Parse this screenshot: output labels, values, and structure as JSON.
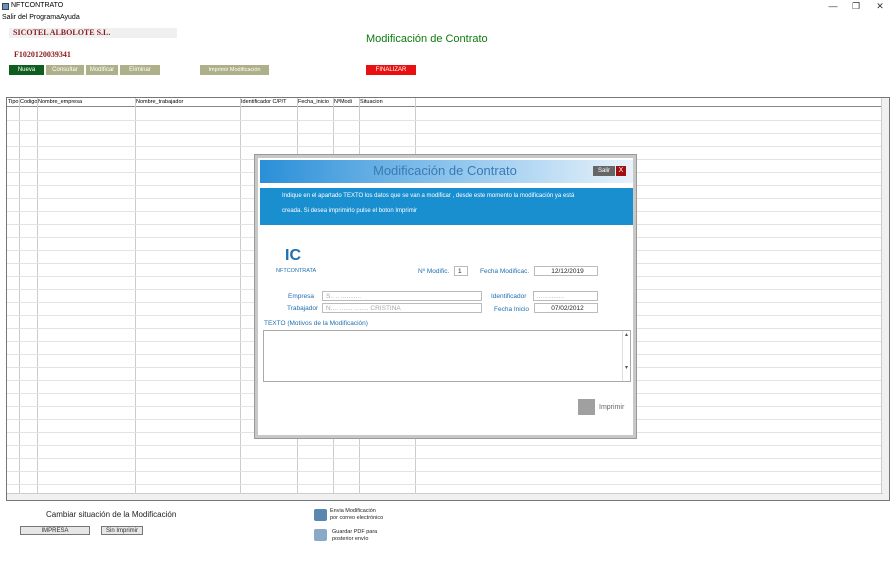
{
  "window": {
    "title": "NFTCONTRATO",
    "min": "—",
    "max": "❐",
    "close": "✕"
  },
  "menu": [
    "Salir del Programa",
    "Ayuda"
  ],
  "company": "SICOTEL ALBOLOTE S.L.",
  "code": "F1020120039341",
  "main_title": "Modificación de Contrato",
  "toolbar": {
    "nueva": "Nueva",
    "consultar": "Consultar",
    "modificar": "Modificar",
    "eliminar": "Eliminar",
    "imprimir": "Imprimir Modificación",
    "finalizar": "FINALIZAR"
  },
  "grid": {
    "columns": [
      "Tipo",
      "Codigo",
      "Nombre_empresa",
      "Nombre_trabajador",
      "Identificador C/P/T",
      "Fecha_inicio",
      "NºModi",
      "Situacion"
    ]
  },
  "dialog": {
    "title": "Modificación de Contrato",
    "salir": "Salir",
    "close": "X",
    "info_line1": "Indique en el apartado TEXTO los datos que se van a modificar , desde este momento la modificación ya está",
    "info_line2": "creada. Si desea imprimirlo pulse el boton Imprimir",
    "logo_mark": "IC",
    "logo_text": "NFTCONTRATA",
    "n_modif_label": "Nº Modific.",
    "n_modif_value": "1",
    "fecha_modif_label": "Fecha Modificac.",
    "fecha_modif_value": "12/12/2019",
    "empresa_label": "Empresa",
    "empresa_value": "S.. .. ...........",
    "identificador_label": "Identificador",
    "identificador_value": "...............",
    "trabajador_label": "Trabajador",
    "trabajador_value": "N.... ....... ........ CRISTINA",
    "fecha_inicio_label": "Fecha Inicio",
    "fecha_inicio_value": "07/02/2012",
    "texto_label": "TEXTO (Motivos de la Modificación)",
    "imprimir": "Imprimir"
  },
  "bottom": {
    "cambiar_label": "Cambiar situación de la Modificación",
    "impresa": "IMPRESA",
    "sin_imprimir": "Sin Imprimir",
    "envia_line1": "Envia Modificación",
    "envia_line2": "por correo electrónico",
    "guardar_line1": "Guardar PDF para",
    "guardar_line2": "posterior envío"
  }
}
